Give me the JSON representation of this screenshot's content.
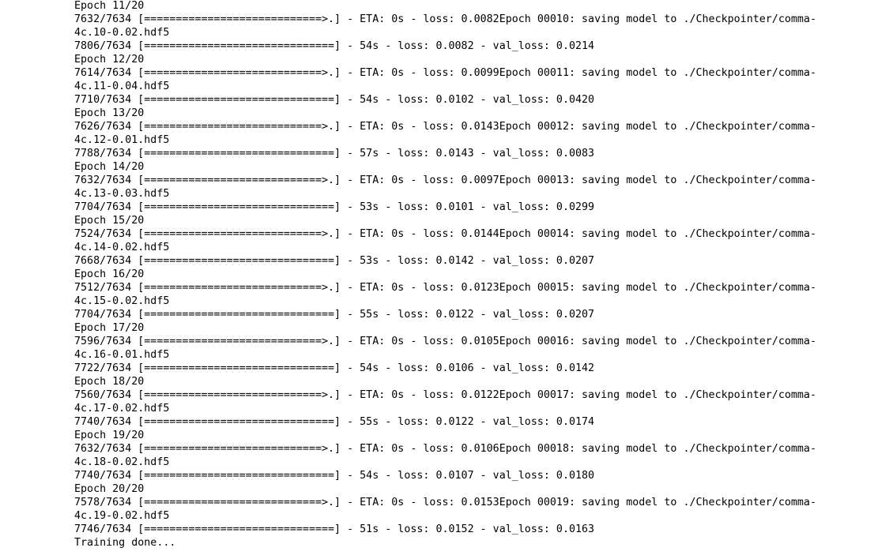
{
  "output": {
    "lines": [
      "Epoch 11/20",
      "7632/7634 [============================>.] - ETA: 0s - loss: 0.0082Epoch 00010: saving model to ./Checkpointer/comma-",
      "4c.10-0.02.hdf5",
      "7806/7634 [==============================] - 54s - loss: 0.0082 - val_loss: 0.0214",
      "Epoch 12/20",
      "7614/7634 [============================>.] - ETA: 0s - loss: 0.0099Epoch 00011: saving model to ./Checkpointer/comma-",
      "4c.11-0.04.hdf5",
      "7710/7634 [==============================] - 54s - loss: 0.0102 - val_loss: 0.0420",
      "Epoch 13/20",
      "7626/7634 [============================>.] - ETA: 0s - loss: 0.0143Epoch 00012: saving model to ./Checkpointer/comma-",
      "4c.12-0.01.hdf5",
      "7788/7634 [==============================] - 57s - loss: 0.0143 - val_loss: 0.0083",
      "Epoch 14/20",
      "7632/7634 [============================>.] - ETA: 0s - loss: 0.0097Epoch 00013: saving model to ./Checkpointer/comma-",
      "4c.13-0.03.hdf5",
      "7704/7634 [==============================] - 53s - loss: 0.0101 - val_loss: 0.0299",
      "Epoch 15/20",
      "7524/7634 [============================>.] - ETA: 0s - loss: 0.0144Epoch 00014: saving model to ./Checkpointer/comma-",
      "4c.14-0.02.hdf5",
      "7668/7634 [==============================] - 53s - loss: 0.0142 - val_loss: 0.0207",
      "Epoch 16/20",
      "7512/7634 [============================>.] - ETA: 0s - loss: 0.0123Epoch 00015: saving model to ./Checkpointer/comma-",
      "4c.15-0.02.hdf5",
      "7704/7634 [==============================] - 55s - loss: 0.0122 - val_loss: 0.0207",
      "Epoch 17/20",
      "7596/7634 [============================>.] - ETA: 0s - loss: 0.0105Epoch 00016: saving model to ./Checkpointer/comma-",
      "4c.16-0.01.hdf5",
      "7722/7634 [==============================] - 54s - loss: 0.0106 - val_loss: 0.0142",
      "Epoch 18/20",
      "7560/7634 [============================>.] - ETA: 0s - loss: 0.0122Epoch 00017: saving model to ./Checkpointer/comma-",
      "4c.17-0.02.hdf5",
      "7740/7634 [==============================] - 55s - loss: 0.0122 - val_loss: 0.0174",
      "Epoch 19/20",
      "7632/7634 [============================>.] - ETA: 0s - loss: 0.0106Epoch 00018: saving model to ./Checkpointer/comma-",
      "4c.18-0.02.hdf5",
      "7740/7634 [==============================] - 54s - loss: 0.0107 - val_loss: 0.0180",
      "Epoch 20/20",
      "7578/7634 [============================>.] - ETA: 0s - loss: 0.0153Epoch 00019: saving model to ./Checkpointer/comma-",
      "4c.19-0.02.hdf5",
      "7746/7634 [==============================] - 51s - loss: 0.0152 - val_loss: 0.0163",
      "Training done..."
    ]
  }
}
